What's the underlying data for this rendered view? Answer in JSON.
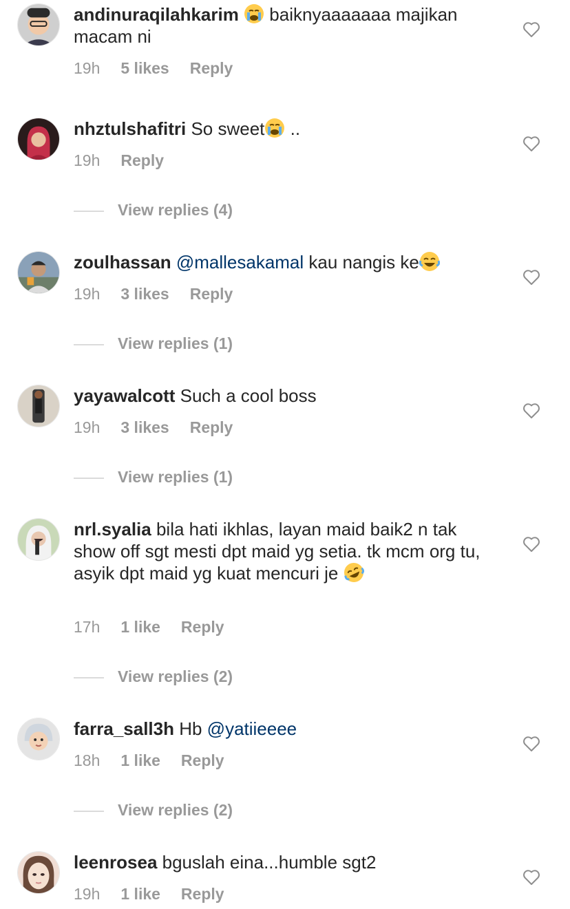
{
  "comments": [
    {
      "username": "andinuraqilahkarim",
      "text_before": "",
      "emoji1": "crying-face",
      "text_after": " baiknyaaaaaaa majikan macam ni",
      "time": "19h",
      "likes": "5 likes",
      "reply": "Reply",
      "avatar_colors": [
        "#cfcfcf",
        "#f1c9a8"
      ]
    },
    {
      "username": "nhztulshafitri",
      "text_before": "So sweet",
      "emoji1": "crying-face",
      "text_after": " ..",
      "time": "19h",
      "likes": "",
      "reply": "Reply",
      "view_replies": "View replies (4)",
      "avatar_colors": [
        "#2a1b1b",
        "#c4304a"
      ]
    },
    {
      "username": "zoulhassan",
      "mention": "@mallesakamal",
      "text_after": " kau nangis ke",
      "emoji_end": "joy-face",
      "time": "19h",
      "likes": "3 likes",
      "reply": "Reply",
      "view_replies": "View replies (1)",
      "avatar_colors": [
        "#8aa1b8",
        "#c49a7a"
      ]
    },
    {
      "username": "yayawalcott",
      "text_after": " Such a cool boss",
      "time": "19h",
      "likes": "3 likes",
      "reply": "Reply",
      "view_replies": "View replies (1)",
      "avatar_colors": [
        "#d9d2c7",
        "#2b2b2b"
      ]
    },
    {
      "username": "nrl.syalia",
      "text_after": " bila hati ikhlas, layan maid baik2 n tak show off sgt mesti dpt maid yg setia. tk mcm org tu, asyik dpt maid yg kuat mencuri je",
      "emoji_end": "rofl-face",
      "time": "17h",
      "likes": "1 like",
      "reply": "Reply",
      "view_replies": "View replies (2)",
      "avatar_colors": [
        "#c9d9b8",
        "#e8d9cf"
      ]
    },
    {
      "username": "farra_sall3h",
      "text_after": " Hb ",
      "mention": "@yatiieeee",
      "time": "18h",
      "likes": "1 like",
      "reply": "Reply",
      "view_replies": "View replies (2)",
      "avatar_colors": [
        "#e4e4e4",
        "#f3d2b6"
      ]
    },
    {
      "username": "leenrosea",
      "text_after": " bguslah eina...humble sgt2",
      "time": "19h",
      "likes": "1 like",
      "reply": "Reply",
      "avatar_colors": [
        "#f0ddd4",
        "#f6e1d2"
      ]
    }
  ]
}
